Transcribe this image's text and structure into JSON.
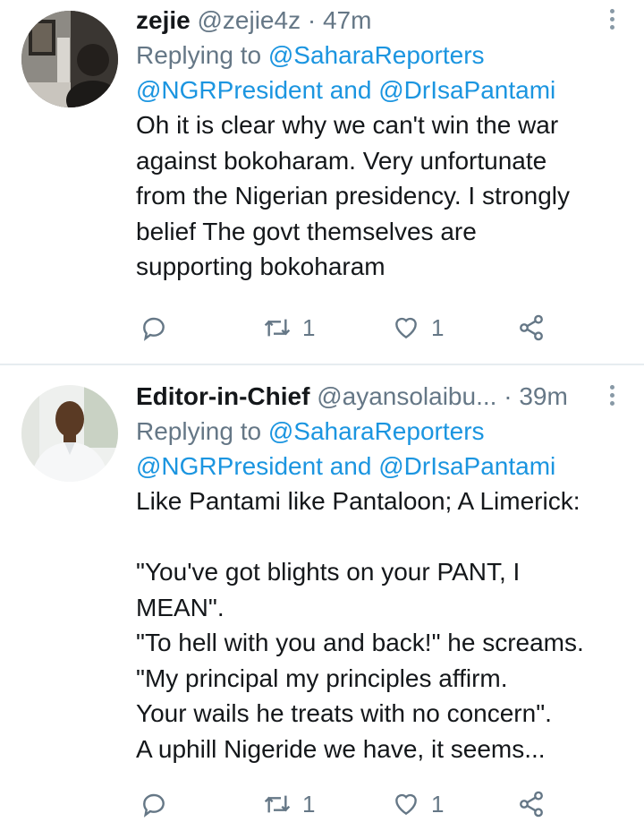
{
  "tweets": [
    {
      "name": "zejie",
      "handle": "@zejie4z",
      "dot": "·",
      "time": "47m",
      "replying_prefix": "Replying to",
      "replying_handle_1": "@SaharaReporters",
      "replying_handle_2": "@NGRPresident",
      "replying_and": "and",
      "replying_handle_3": "@DrIsaPantami",
      "text": "Oh it is clear why we can't win the war\nagainst bokoharam. Very unfortunate\nfrom the Nigerian presidency. I strongly\nbelief The govt themselves are\nsupporting bokoharam",
      "retweets": "1",
      "likes": "1"
    },
    {
      "name": "Editor-in-Chief",
      "handle": "@ayansolaibu...",
      "dot": "·",
      "time": "39m",
      "replying_prefix": "Replying to",
      "replying_handle_1": "@SaharaReporters",
      "replying_handle_2": "@NGRPresident",
      "replying_and": "and",
      "replying_handle_3": "@DrIsaPantami",
      "text": "Like Pantami like Pantaloon; A Limerick:\n\n\"You've got blights on your PANT, I\nMEAN\".\n\"To hell with you and back!\" he screams.\n\"My principal my principles affirm.\nYour wails he treats with no concern\".\nA uphill Nigeride we have, it seems...",
      "retweets": "1",
      "likes": "1"
    }
  ],
  "icons": {
    "reply": "reply-icon",
    "retweet": "retweet-icon",
    "like": "heart-icon",
    "share": "share-icon",
    "more": "more-vertical-icon"
  },
  "colors": {
    "link": "#1b95e0",
    "secondary": "#657786",
    "divider": "#e6ecf0"
  }
}
